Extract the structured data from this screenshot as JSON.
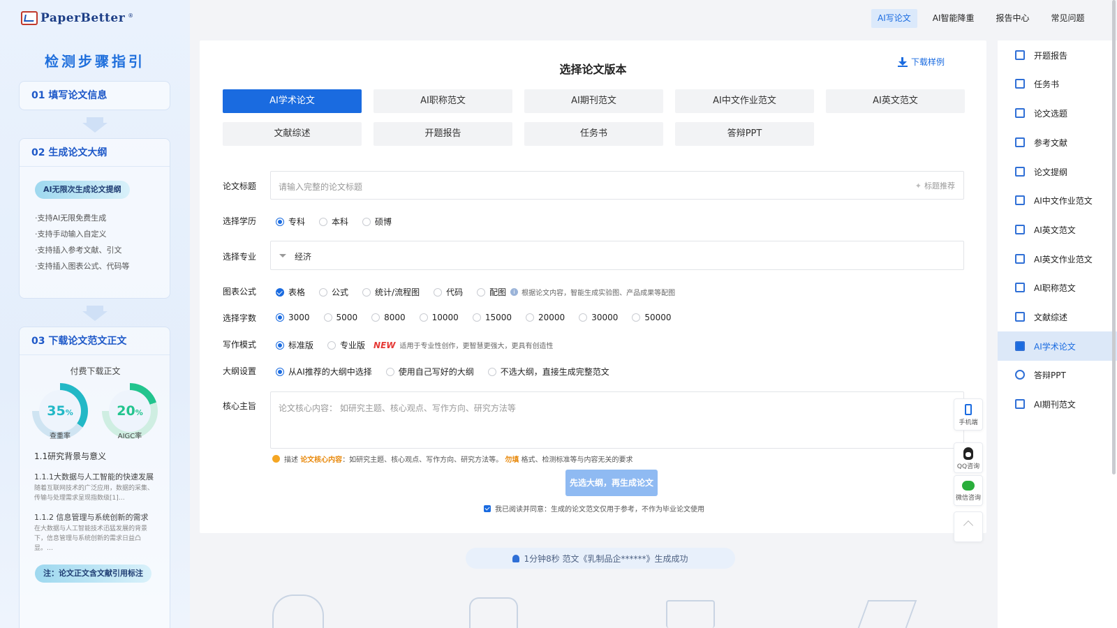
{
  "brand": {
    "name": "PaperBetter"
  },
  "topnav": [
    {
      "label": "AI写论文",
      "active": true
    },
    {
      "label": "AI智能降重",
      "active": false
    },
    {
      "label": "报告中心",
      "active": false
    },
    {
      "label": "常见问题",
      "active": false
    }
  ],
  "guide": {
    "title": "检测步骤指引",
    "step1": "01  填写论文信息",
    "step2": "02  生成论文大纲",
    "step2_pill": "AI无限次生成论文提纲",
    "step2_bullets": [
      "·支持AI无限免费生成",
      "·支持手动输入自定义",
      "·支持插入参考文献、引文",
      "·支持插入图表公式、代码等"
    ],
    "step3": "03  下载论文范文正文",
    "paid": "付费下载正文",
    "dup_rate": "35",
    "dup_label": "查重率",
    "aigc_rate": "20",
    "aigc_label": "AIGC率",
    "percent": "%",
    "sec1": "1.1研究背景与意义",
    "sec11": "1.1.1大数据与人工智能的快速发展",
    "sec11_text": "随着互联网技术的广泛应用，数据的采集、传输与处理需求呈现指数级[1]…",
    "sec12": "1.1.2 信息管理与系统创新的需求",
    "sec12_text": "在大数据与人工智能技术迅猛发展的背景下，信息管理与系统创新的需求日益凸显。…",
    "footnote": "注：论文正文含文献引用标注"
  },
  "main": {
    "title": "选择论文版本",
    "download_sample": "下载样例",
    "versions": [
      {
        "label": "AI学术论文",
        "active": true
      },
      {
        "label": "AI职称范文",
        "active": false
      },
      {
        "label": "AI期刊范文",
        "active": false
      },
      {
        "label": "AI中文作业范文",
        "active": false
      },
      {
        "label": "AI英文范文",
        "active": false
      },
      {
        "label": "文献综述",
        "active": false
      },
      {
        "label": "开题报告",
        "active": false
      },
      {
        "label": "任务书",
        "active": false
      },
      {
        "label": "答辩PPT",
        "active": false
      }
    ],
    "labels": {
      "title": "论文标题",
      "degree": "选择学历",
      "major": "选择专业",
      "charts": "图表公式",
      "words": "选择字数",
      "mode": "写作模式",
      "outline": "大纲设置",
      "core": "核心主旨"
    },
    "title_placeholder": "请输入完整的论文标题",
    "title_recommend": "标题推荐",
    "degree_options": [
      {
        "label": "专科",
        "checked": true
      },
      {
        "label": "本科",
        "checked": false
      },
      {
        "label": "硕博",
        "checked": false
      }
    ],
    "major_value": "经济",
    "chart_options": [
      {
        "label": "表格",
        "checked": true
      },
      {
        "label": "公式",
        "checked": false
      },
      {
        "label": "统计/流程图",
        "checked": false
      },
      {
        "label": "代码",
        "checked": false
      },
      {
        "label": "配图",
        "checked": false
      }
    ],
    "chart_note": "根据论文内容，智能生成实验图、产品成果等配图",
    "word_options": [
      {
        "label": "3000",
        "checked": true
      },
      {
        "label": "5000",
        "checked": false
      },
      {
        "label": "8000",
        "checked": false
      },
      {
        "label": "10000",
        "checked": false
      },
      {
        "label": "15000",
        "checked": false
      },
      {
        "label": "20000",
        "checked": false
      },
      {
        "label": "30000",
        "checked": false
      },
      {
        "label": "50000",
        "checked": false
      }
    ],
    "mode_options": [
      {
        "label": "标准版",
        "checked": true
      },
      {
        "label": "专业版",
        "checked": false
      }
    ],
    "mode_new": "NEW",
    "mode_note": "适用于专业性创作，更智慧更强大，更具有创造性",
    "outline_options": [
      {
        "label": "从AI推荐的大纲中选择",
        "checked": true
      },
      {
        "label": "使用自己写好的大纲",
        "checked": false
      },
      {
        "label": "不选大纲，直接生成完整范文",
        "checked": false
      }
    ],
    "core_placeholder": "论文核心内容： 如研究主题、核心观点、写作方向、研究方法等",
    "tip_prefix": "描述",
    "tip_key": "论文核心内容",
    "tip_mid": "：如研究主题、核心观点、写作方向、研究方法等。",
    "tip_warn": "勿填",
    "tip_suffix": "格式、检测标准等与内容无关的要求",
    "submit": "先选大纲，再生成论文",
    "agree": "我已阅读并同意：生成的论文范文仅用于参考，不作为毕业论文使用"
  },
  "float_tools": {
    "mobile": "手机端",
    "qq": "QQ咨询",
    "wechat": "微信咨询"
  },
  "notice": "1分钟8秒 范文《乳制品企******》生成成功",
  "sidebar": [
    {
      "label": "开题报告",
      "active": false
    },
    {
      "label": "任务书",
      "active": false
    },
    {
      "label": "论文选题",
      "active": false
    },
    {
      "label": "参考文献",
      "active": false
    },
    {
      "label": "论文提纲",
      "active": false
    },
    {
      "label": "AI中文作业范文",
      "active": false
    },
    {
      "label": "AI英文范文",
      "active": false
    },
    {
      "label": "AI英文作业范文",
      "active": false
    },
    {
      "label": "AI职称范文",
      "active": false
    },
    {
      "label": "文献综述",
      "active": false
    },
    {
      "label": "AI学术论文",
      "active": true
    },
    {
      "label": "答辩PPT",
      "active": false
    },
    {
      "label": "AI期刊范文",
      "active": false
    }
  ],
  "colors": {
    "accent": "#1a6be0",
    "gauge": "#22b8c6",
    "new": "#e53935",
    "tip": "#e8890c"
  }
}
